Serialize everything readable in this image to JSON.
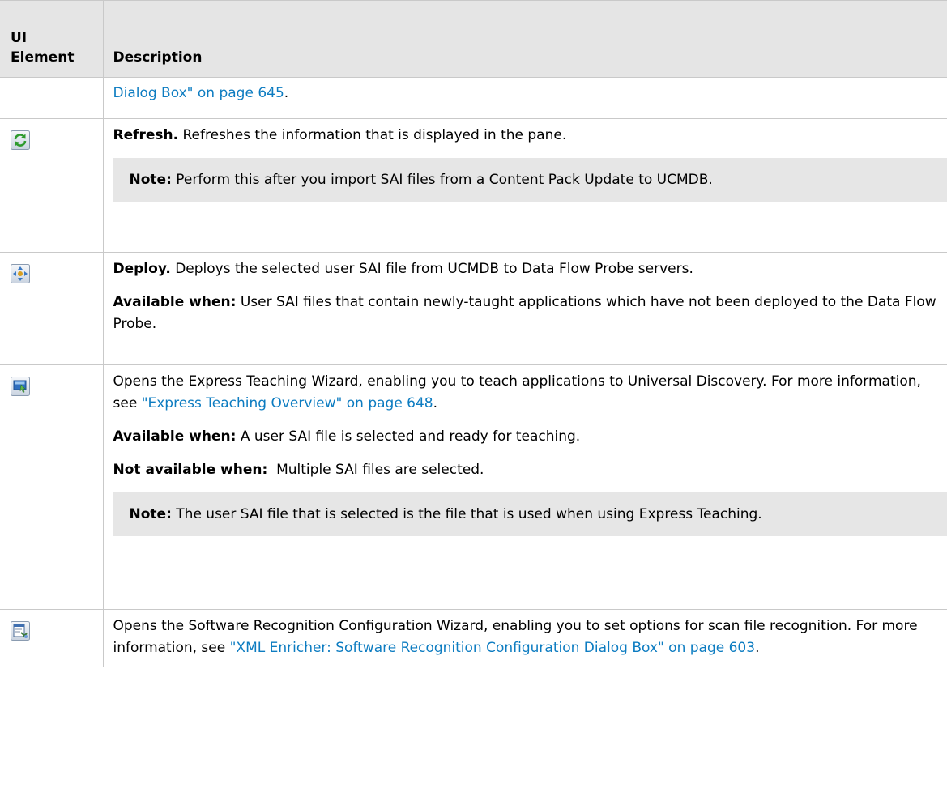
{
  "table": {
    "header": {
      "col1": "UI Element",
      "col2": "Description"
    },
    "row_continuation": {
      "link_text": "Dialog Box\" on page 645",
      "tail": "."
    },
    "refresh_row": {
      "icon": "refresh-icon",
      "label": "Refresh.",
      "text": " Refreshes the information that is displayed in the pane.",
      "note_label": "Note:",
      "note_text": " Perform this after you import SAI files from a Content Pack Update to UCMDB."
    },
    "deploy_row": {
      "icon": "deploy-icon",
      "label": "Deploy.",
      "text": " Deploys the selected user SAI file from UCMDB to Data Flow Probe servers.",
      "avail_label": "Available when:",
      "avail_text": " User SAI files that contain newly-taught applications which have not been deployed to the Data Flow Probe."
    },
    "teaching_row": {
      "icon": "express-teaching-icon",
      "text": "Opens the Express Teaching Wizard, enabling you to teach applications to Universal Discovery. For more information, see ",
      "link": "\"Express Teaching Overview\" on page 648",
      "tail": ".",
      "avail_label": "Available when:",
      "avail_text": " A user SAI file is selected and ready for teaching.",
      "not_avail_label": "Not available when:",
      "not_avail_text": "  Multiple SAI files are selected.",
      "note_label": "Note:",
      "note_text": " The user SAI file that is selected is the file that is used when using Express Teaching."
    },
    "recognition_row": {
      "icon": "software-recognition-config-icon",
      "text": "Opens the Software Recognition Configuration Wizard, enabling you to set options for scan file recognition. For more information, see ",
      "link": "\"XML Enricher: Software Recognition Configuration Dialog Box\" on page 603",
      "tail": "."
    }
  }
}
